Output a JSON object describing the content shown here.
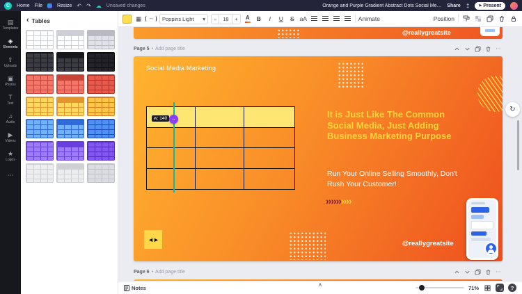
{
  "topbar": {
    "home": "Home",
    "file": "File",
    "resize": "Resize",
    "undo_icon": "↶",
    "redo_icon": "↷",
    "cloud_icon": "☁",
    "status": "Unsaved changes",
    "doc_title": "Orange and Purple Gradient Abstract Dots Social Media Ma...",
    "share": "Share",
    "publish_icon": "↥",
    "present": "Present",
    "present_play_icon": "▶",
    "logo_letter": "C"
  },
  "sidebar": {
    "items": [
      {
        "name": "templates",
        "icon": "▤",
        "label": "Templates"
      },
      {
        "name": "elements",
        "icon": "◈",
        "label": "Elements"
      },
      {
        "name": "uploads",
        "icon": "⇧",
        "label": "Uploads"
      },
      {
        "name": "photos",
        "icon": "▣",
        "label": "Photos"
      },
      {
        "name": "text",
        "icon": "T",
        "label": "Text"
      },
      {
        "name": "audio",
        "icon": "♫",
        "label": "Audio"
      },
      {
        "name": "videos",
        "icon": "▶",
        "label": "Videos"
      },
      {
        "name": "logos",
        "icon": "★",
        "label": "Logos"
      },
      {
        "name": "more",
        "icon": "⋯",
        "label": ""
      }
    ]
  },
  "tables_panel": {
    "back_icon": "‹",
    "title": "Tables",
    "thumbnails": [
      {
        "bg": "#ffffff",
        "line": "#cdced6"
      },
      {
        "bg": "#ffffff",
        "line": "#cdced6",
        "header": true
      },
      {
        "bg": "#e2e3e9",
        "line": "#b9bac2",
        "header": true
      },
      {
        "bg": "#3b3b43",
        "line": "#17171c"
      },
      {
        "bg": "#3b3b43",
        "line": "#17171c",
        "header": true
      },
      {
        "bg": "#222228",
        "line": "#0c0c10"
      },
      {
        "bg": "#f2766a",
        "line": "#c74437"
      },
      {
        "bg": "#f2766a",
        "line": "#c74437",
        "header": true
      },
      {
        "bg": "#ea584c",
        "line": "#b03328"
      },
      {
        "bg": "#ffd95e",
        "line": "#e3962f"
      },
      {
        "bg": "#ffd95e",
        "line": "#e3962f",
        "header": true
      },
      {
        "bg": "#ffc844",
        "line": "#d97f22"
      },
      {
        "bg": "#74b2f8",
        "line": "#2f6bd9"
      },
      {
        "bg": "#74b2f8",
        "line": "#2f6bd9",
        "header": true
      },
      {
        "bg": "#4f93f2",
        "line": "#1f4fc0"
      },
      {
        "bg": "#9d7cf8",
        "line": "#6a3fe0"
      },
      {
        "bg": "#9d7cf8",
        "line": "#6a3fe0",
        "header": true
      },
      {
        "bg": "#8257f0",
        "line": "#5429c8"
      },
      {
        "bg": "#eceded",
        "line": "#cfd0d6"
      },
      {
        "bg": "#eceded",
        "line": "#cfd0d6",
        "header": true
      },
      {
        "bg": "#dcdde2",
        "line": "#bfc0c8"
      }
    ]
  },
  "toolbar": {
    "table_icon": "▦",
    "spacing_icon": "↔",
    "font_name": "Poppins Light",
    "font_chevron_icon": "▾",
    "size_minus": "−",
    "font_size": "18",
    "size_plus": "+",
    "color_letter": "A",
    "bold": "B",
    "italic": "I",
    "underline": "U",
    "strikethrough": "S",
    "case_label": "aA",
    "animate": "Animate",
    "position": "Position"
  },
  "pages": {
    "separator": "•",
    "add_title": "Add page title",
    "p5_label": "Page 5",
    "p6_label": "Page 6",
    "more_icon": "⋯"
  },
  "page4": {
    "handle": "@reallygreatsite"
  },
  "page5": {
    "kicker": "Social Media Marketing",
    "heading": "It is Just Like The Common Social Media, Just Adding Business Marketing Purpose",
    "body": "Run Your Online Selling Smoothly, Don't Rush Your Customer!",
    "handle": "@reallygreatsite",
    "logo_glyph": "◄►",
    "chevrons_dark": "››››››",
    "chevrons_light": "››››",
    "table": {
      "rows": 4,
      "cols": 3,
      "tooltip": "w: 140",
      "resize_icon": "↔"
    }
  },
  "assistant": {
    "icon": "↻"
  },
  "bottombar": {
    "notes": "Notes",
    "collapse_icon": "∧",
    "zoom": "71%",
    "help": "?"
  },
  "colors": {
    "page_gradient_start": "#FFB42E",
    "page_gradient_end": "#EE4E1E",
    "heading_yellow": "#FFD43B",
    "table_fill": "#FFE672",
    "guide_teal": "#00BFA5",
    "handle_purple": "#8B3DFF",
    "swatch_yellow": "#FFDF4D",
    "chevron_dark": "#7D1F38"
  }
}
